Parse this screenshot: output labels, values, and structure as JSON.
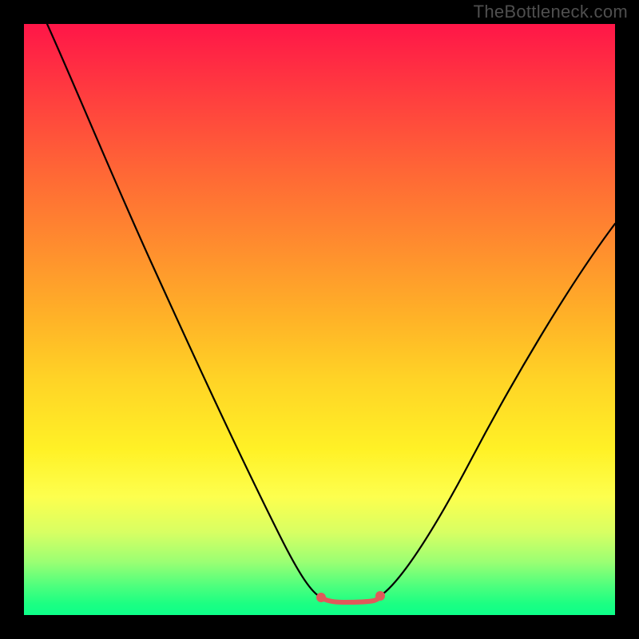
{
  "watermark": "TheBottleneck.com",
  "chart_data": {
    "type": "line",
    "title": "",
    "xlabel": "",
    "ylabel": "",
    "xlim": [
      0,
      100
    ],
    "ylim": [
      0,
      100
    ],
    "description": "V-shaped performance bottleneck curve plotted over a red-to-green vertical gradient background. The black curve falls from the top-left corner, reaches a minimum near x≈55 where a small red flat segment with end dots marks the optimal zone, then rises toward the upper-right.",
    "series": [
      {
        "name": "left-branch",
        "x": [
          4,
          10,
          16,
          22,
          28,
          34,
          40,
          46,
          50
        ],
        "y": [
          100,
          88,
          75,
          63,
          51,
          39,
          27,
          14,
          4
        ]
      },
      {
        "name": "optimal-segment",
        "x": [
          50,
          52,
          55,
          58,
          60
        ],
        "y": [
          3.5,
          2.6,
          2.4,
          2.6,
          3.5
        ]
      },
      {
        "name": "right-branch",
        "x": [
          60,
          66,
          72,
          78,
          84,
          90,
          96,
          100
        ],
        "y": [
          4,
          12,
          21,
          30,
          40,
          50,
          60,
          66
        ]
      }
    ],
    "colors": {
      "curve": "#000000",
      "optimal_marker": "#e05a5a",
      "gradient_top": "#ff1648",
      "gradient_bottom": "#0dff89"
    }
  }
}
